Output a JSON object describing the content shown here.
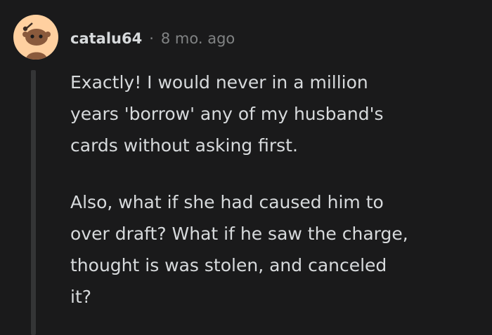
{
  "comment": {
    "author": "catalu64",
    "separator": "·",
    "time": "8 mo. ago",
    "avatar_icon": "reddit-snoo-avatar-icon",
    "paragraphs": [
      "Exactly! I would never in a million\nyears 'borrow' any of my husband's\ncards without asking first.",
      "Also, what if she had caused him to\nover draft? What if he saw the charge,\nthought is was stolen, and canceled\nit?"
    ]
  },
  "colors": {
    "background": "#1a1a1b",
    "text": "#d7dadc",
    "meta": "#818384",
    "thread_line": "#343536",
    "avatar_bg": "#ffd0a0"
  }
}
